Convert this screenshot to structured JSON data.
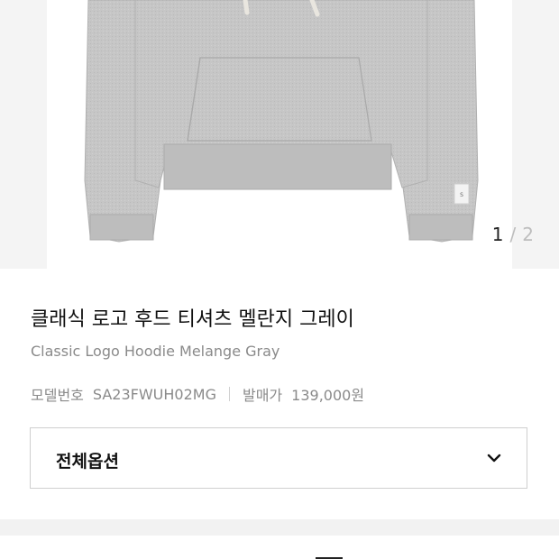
{
  "gallery": {
    "current_index": "1",
    "separator": "/",
    "total": "2",
    "image_alt_icon": "hoodie-product-photo"
  },
  "product": {
    "name_ko": "클래식 로고 후드 티셔츠 멜란지 그레이",
    "name_en": "Classic Logo Hoodie Melange Gray",
    "model_label": "모델번호",
    "model_number": "SA23FWUH02MG",
    "price_label": "발매가",
    "price": "139,000원"
  },
  "options": {
    "select_label": "전체옵션",
    "icon": "chevron-down-icon"
  },
  "colors": {
    "hoodie": "#c5c5c5",
    "background": "#f4f4f4",
    "text_primary": "#111111",
    "text_secondary": "#8a8a8a"
  }
}
